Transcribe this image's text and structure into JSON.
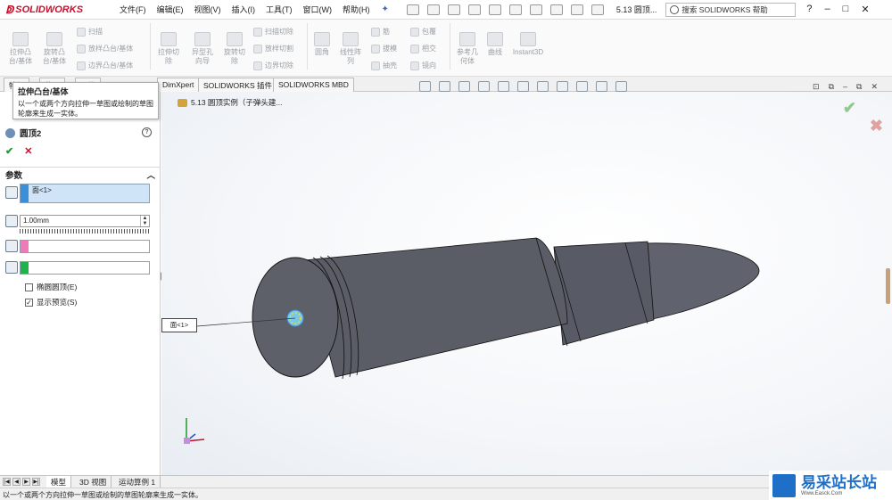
{
  "app": {
    "logo_text": "SOLIDWORKS",
    "doc_title": "5.13 圆顶..."
  },
  "menu": [
    "文件(F)",
    "编辑(E)",
    "视图(V)",
    "插入(I)",
    "工具(T)",
    "窗口(W)",
    "帮助(H)"
  ],
  "search": {
    "placeholder": "搜索 SOLIDWORKS 帮助"
  },
  "ribbon": {
    "extrude_boss": "拉伸凸\n台/基体",
    "revolve_boss": "旋转凸\n台/基体",
    "sweep": "扫描",
    "loft": "放样凸台/基体",
    "boundary": "边界凸台/基体",
    "extrude_cut": "拉伸切\n除",
    "hole_wizard": "异型孔\n向导",
    "revolve_cut": "旋转切\n除",
    "sweep_cut": "扫描切除",
    "loft_cut": "放样切割",
    "boundary_cut": "边界切除",
    "fillet": "圆角",
    "linear_pattern": "线性阵\n列",
    "rib": "筋",
    "draft": "拔模",
    "shell": "抽壳",
    "wrap": "包覆",
    "intersect": "相交",
    "mirror": "镜向",
    "ref_geometry": "参考几\n何体",
    "curves": "曲线",
    "instant3d": "Instant3D"
  },
  "tabs": [
    "特征",
    "草图",
    "评估",
    "DimXpert",
    "SOLIDWORKS 插件",
    "SOLIDWORKS MBD"
  ],
  "tooltip": {
    "title": "拉伸凸台/基体",
    "body": "以一个或两个方向拉伸一草图或绘制的草图轮廓来生成一实体。"
  },
  "panel": {
    "feature_name": "圆顶2",
    "section_title": "参数",
    "face_selection": "面<1>",
    "distance": "1.00mm",
    "elliptical_dome": "椭圆圆顶(E)",
    "show_preview": "显示预览(S)",
    "elliptical_checked": false,
    "preview_checked": true
  },
  "viewport": {
    "breadcrumb": "5.13 圆顶实例（子弹头建...",
    "callout": "面<1>"
  },
  "bottom_tabs": [
    "模型",
    "3D 视图",
    "运动算例 1"
  ],
  "status": "以一个或两个方向拉伸一草图或绘制的草图轮廓来生成一实体。",
  "watermark": {
    "main": "易采站长站",
    "sub": "Www.Easck.Com"
  },
  "colors": {
    "brand": "#c8102e",
    "selection": "#cfe4f7",
    "strip_blue": "#3d8ed8",
    "strip_pink": "#f07ab8",
    "strip_green": "#22b24c",
    "model_body": "#5a5d66",
    "ok_green": "#1e9b2a"
  }
}
